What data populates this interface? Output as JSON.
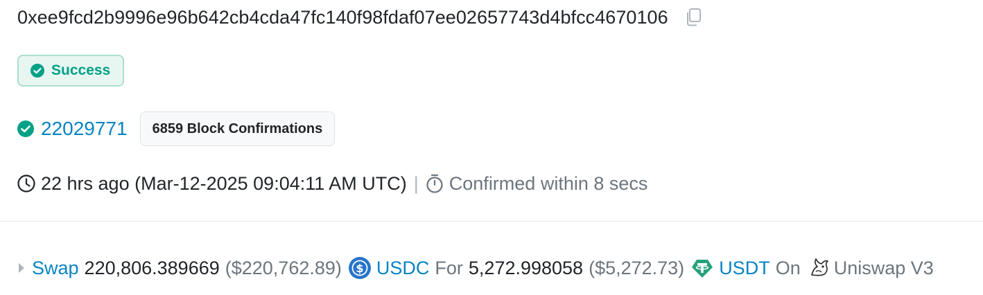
{
  "transaction": {
    "hash": "0xee9fcd2b9996e96b642cb4cda47fc140f98fdaf07ee02657743d4bfcc4670106",
    "copy_icon": "copy-icon"
  },
  "status": {
    "label": "Success",
    "icon": "check-circle-icon",
    "color": "#00a186"
  },
  "block": {
    "number": "22029771",
    "confirmations": "6859 Block Confirmations"
  },
  "timestamp": {
    "relative_and_full": "22 hrs ago (Mar-12-2025 09:04:11 AM UTC)",
    "separator": "|",
    "confirmed": "Confirmed within 8 secs"
  },
  "action": {
    "verb": "Swap",
    "amount_in": "220,806.389669",
    "amount_in_usd": "($220,762.89)",
    "token_in": "USDC",
    "for_label": "For",
    "amount_out": "5,272.998058",
    "amount_out_usd": "($5,272.73)",
    "token_out": "USDT",
    "on_label": "On",
    "dex": "Uniswap V3"
  },
  "colors": {
    "link": "#0784c3",
    "muted": "#6c757d",
    "usdc": "#2775ca",
    "usdt": "#26a17b"
  }
}
